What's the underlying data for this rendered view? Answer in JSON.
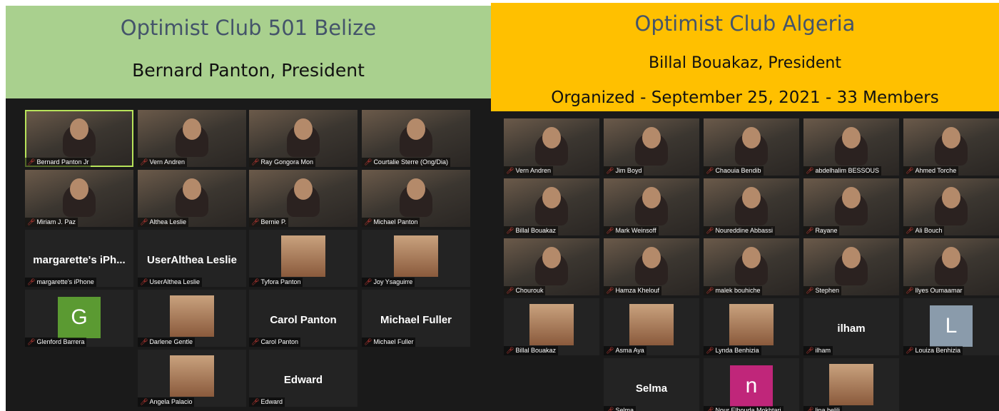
{
  "left": {
    "club_name": "Optimist Club 501 Belize",
    "president": "Bernard Panton, President",
    "participants": [
      {
        "label": "Bernard Panton Jr",
        "type": "video"
      },
      {
        "label": "Vern Andren",
        "type": "video"
      },
      {
        "label": "Ray Gongora Mon",
        "type": "video"
      },
      {
        "label": "Courtalie Sterre (Ong/Dia)",
        "type": "video"
      },
      {
        "label": "Miriam J. Paz",
        "type": "video"
      },
      {
        "label": "Althea Leslie",
        "type": "video"
      },
      {
        "label": "Bernie P.",
        "type": "video"
      },
      {
        "label": "Michael Panton",
        "type": "video"
      },
      {
        "label": "margarette's iPhone",
        "big": "margarette's iPh...",
        "type": "name"
      },
      {
        "label": "UserAlthea Leslie",
        "big": "UserAlthea Leslie",
        "type": "name"
      },
      {
        "label": "Tyfora Panton",
        "type": "photo"
      },
      {
        "label": "Joy Ysaguirre",
        "type": "photo"
      },
      {
        "label": "Glenford Barrera",
        "letter": "G",
        "type": "letter"
      },
      {
        "label": "Darlene Gentle",
        "type": "photo"
      },
      {
        "label": "Carol Panton",
        "big": "Carol Panton",
        "type": "name"
      },
      {
        "label": "Michael Fuller",
        "big": "Michael Fuller",
        "type": "name"
      },
      {
        "label": "Angela Palacio",
        "type": "photo"
      },
      {
        "label": "Edward",
        "big": "Edward",
        "type": "name"
      }
    ],
    "active_speaker_color": "#b7e35a",
    "letter_avatar_color": "#5b9a32"
  },
  "right": {
    "club_name": "Optimist Club Algeria",
    "president": "Billal Bouakaz, President",
    "organized": "Organized - September 25, 2021 - 33 Members",
    "participants": [
      {
        "label": "Vern Andren",
        "type": "video"
      },
      {
        "label": "Jim Boyd",
        "type": "video"
      },
      {
        "label": "Chaouia Bendib",
        "type": "video"
      },
      {
        "label": "abdelhalim BESSOUS",
        "type": "video"
      },
      {
        "label": "Ahmed Torche",
        "type": "video"
      },
      {
        "label": "Billal Bouakaz",
        "type": "video"
      },
      {
        "label": "Mark Weinsoff",
        "type": "video"
      },
      {
        "label": "Noureddine Abbassi",
        "type": "video"
      },
      {
        "label": "Rayane",
        "type": "video"
      },
      {
        "label": "Ali Bouch",
        "type": "video"
      },
      {
        "label": "Chourouk",
        "type": "video"
      },
      {
        "label": "Hamza Khelouf",
        "type": "video"
      },
      {
        "label": "malek bouhiche",
        "type": "video"
      },
      {
        "label": "Stephen",
        "type": "video"
      },
      {
        "label": "Ilyes Oumaamar",
        "type": "video"
      },
      {
        "label": "Billal Bouakaz",
        "type": "photo"
      },
      {
        "label": "Asma Aya",
        "type": "photo"
      },
      {
        "label": "Lynda Benhizia",
        "type": "photo"
      },
      {
        "label": "ilham",
        "big": "ilham",
        "type": "name"
      },
      {
        "label": "Louiza Benhizia",
        "letter": "L",
        "type": "letter"
      },
      {
        "label": "Selma",
        "big": "Selma",
        "type": "name"
      },
      {
        "label": "Nour Elhouda Mokhtari",
        "letter": "n",
        "type": "letter"
      },
      {
        "label": "lina belili",
        "type": "photo"
      }
    ],
    "letter_colors": {
      "L": "#8a9bab",
      "n": "#c0267a"
    }
  }
}
